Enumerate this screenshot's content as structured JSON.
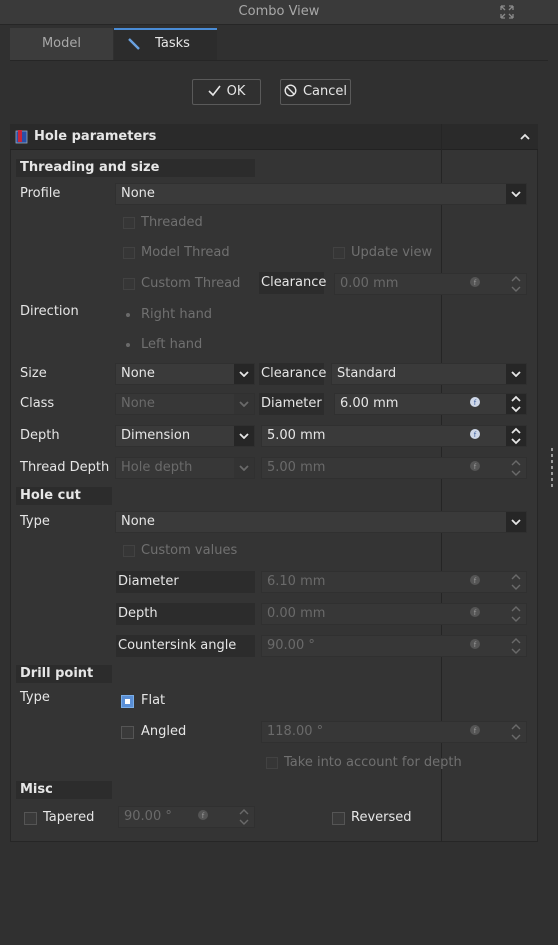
{
  "window": {
    "title": "Combo View"
  },
  "tabs": [
    {
      "label": "Model"
    },
    {
      "label": "Tasks"
    }
  ],
  "dialog": {
    "ok_label": "OK",
    "cancel_label": "Cancel"
  },
  "panel": {
    "title": "Hole parameters"
  },
  "threading": {
    "header": "Threading and size",
    "profile_label": "Profile",
    "profile_value": "None",
    "threaded_label": "Threaded",
    "model_thread_label": "Model Thread",
    "update_view_label": "Update view",
    "custom_thread_label": "Custom Thread",
    "clearance_label": "Clearance",
    "clearance_value": "0.00 mm",
    "direction_label": "Direction",
    "right_hand_label": "Right hand",
    "left_hand_label": "Left hand",
    "size_label": "Size",
    "size_value": "None",
    "size_clearance_label": "Clearance",
    "size_clearance_value": "Standard",
    "class_label": "Class",
    "class_value": "None",
    "diameter_label": "Diameter",
    "diameter_value": "6.00 mm",
    "depth_label": "Depth",
    "depth_type_value": "Dimension",
    "depth_value": "5.00 mm",
    "thread_depth_label": "Thread Depth",
    "thread_depth_type_value": "Hole depth",
    "thread_depth_value": "5.00 mm"
  },
  "hole_cut": {
    "header": "Hole cut",
    "type_label": "Type",
    "type_value": "None",
    "custom_values_label": "Custom values",
    "diameter_label": "Diameter",
    "diameter_value": "6.10 mm",
    "depth_label": "Depth",
    "depth_value": "0.00 mm",
    "countersink_label": "Countersink angle",
    "countersink_value": "90.00 °"
  },
  "drill_point": {
    "header": "Drill point",
    "type_label": "Type",
    "flat_label": "Flat",
    "angled_label": "Angled",
    "angle_value": "118.00 °",
    "take_into_account_label": "Take into account for depth"
  },
  "misc": {
    "header": "Misc",
    "tapered_label": "Tapered",
    "tapered_value": "90.00 °",
    "reversed_label": "Reversed"
  },
  "colors": {
    "accent": "#4a8cd6",
    "background": "#303030",
    "panel": "#343434"
  }
}
